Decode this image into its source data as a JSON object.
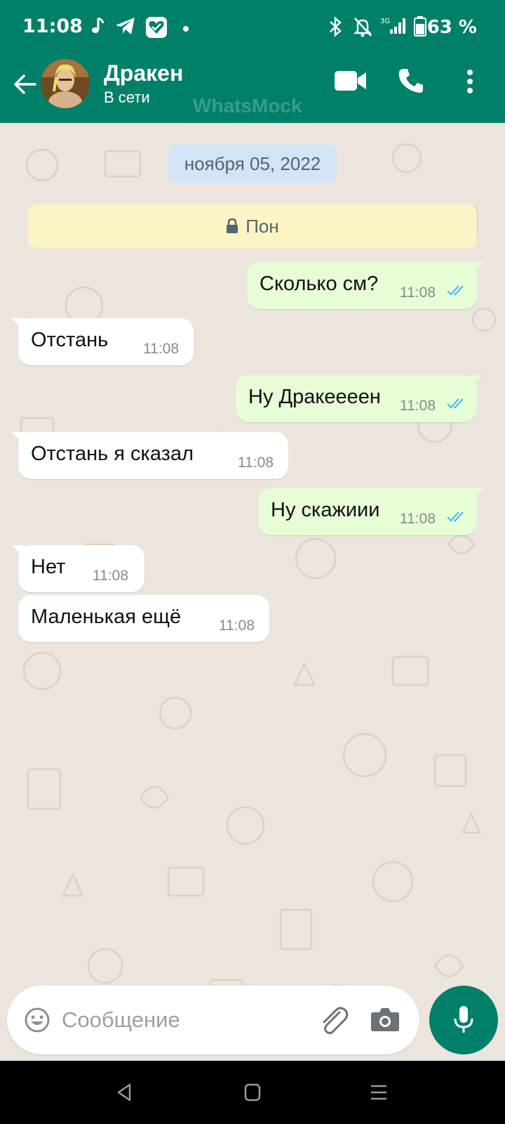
{
  "status_bar": {
    "time": "11:08",
    "battery": "63 %"
  },
  "header": {
    "contact_name": "Дракен",
    "contact_status": "В сети",
    "watermark": "WhatsMock",
    "icons": [
      "back-arrow-icon",
      "video-call-icon",
      "phone-icon",
      "more-vert-icon"
    ]
  },
  "chat": {
    "date_chip": "ноября 05, 2022",
    "encryption_notice": "Пон",
    "messages": [
      {
        "direction": "out",
        "text": "Сколько см?",
        "time": "11:08",
        "read": true
      },
      {
        "direction": "in",
        "text": "Отстань",
        "time": "11:08"
      },
      {
        "direction": "out",
        "text": "Ну Дракеееен",
        "time": "11:08",
        "read": true
      },
      {
        "direction": "in",
        "text": "Отстань я сказал",
        "time": "11:08"
      },
      {
        "direction": "out",
        "text": "Ну скажиии",
        "time": "11:08",
        "read": true
      },
      {
        "direction": "in",
        "text": "Нет",
        "time": "11:08"
      },
      {
        "direction": "in",
        "text": "Маленькая ещё",
        "time": "11:08"
      }
    ]
  },
  "composer": {
    "placeholder": "Сообщение"
  },
  "colors": {
    "header": "#008069",
    "outgoing_bubble": "#E7FDD6",
    "incoming_bubble": "#FFFFFF",
    "read_ticks": "#53BDEB",
    "chat_bg": "#ECE5DD"
  }
}
